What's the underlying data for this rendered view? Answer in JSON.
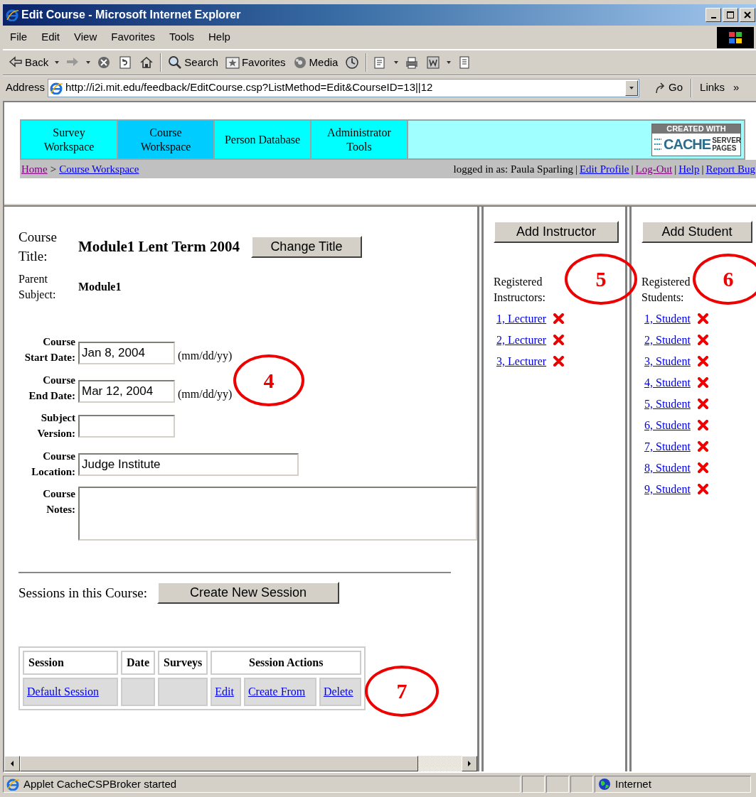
{
  "window": {
    "title": "Edit Course - Microsoft Internet Explorer"
  },
  "menu": [
    "File",
    "Edit",
    "View",
    "Favorites",
    "Tools",
    "Help"
  ],
  "toolbar": [
    {
      "kind": "back",
      "label": "Back",
      "dropdown": true
    },
    {
      "kind": "forward",
      "dropdown": true
    },
    {
      "kind": "stop"
    },
    {
      "kind": "refresh"
    },
    {
      "kind": "home"
    },
    {
      "kind": "search",
      "label": "Search"
    },
    {
      "kind": "favorites",
      "label": "Favorites"
    },
    {
      "kind": "media",
      "label": "Media"
    },
    {
      "kind": "history"
    },
    {
      "kind": "mail",
      "dropdown": true
    },
    {
      "kind": "print"
    },
    {
      "kind": "edit",
      "dropdown": true
    },
    {
      "kind": "discuss"
    }
  ],
  "address": {
    "label": "Address",
    "value": "http://i2i.mit.edu/feedback/EditCourse.csp?ListMethod=Edit&CourseID=13||12",
    "go": "Go",
    "links": "Links",
    "more": "»"
  },
  "site_nav": {
    "tabs": [
      {
        "label": "Survey Workspace",
        "selected": false
      },
      {
        "label": "Course Workspace",
        "selected": true
      },
      {
        "label": "Person Database",
        "selected": false
      },
      {
        "label": "Administrator Tools",
        "selected": false
      }
    ],
    "logo": {
      "top": "CREATED WITH",
      "main": "CACHE",
      "side": [
        "SERVER",
        "PAGES"
      ]
    },
    "breadcrumb": [
      {
        "label": "Home",
        "visited": true
      },
      {
        "label": "Course Workspace",
        "visited": false
      }
    ],
    "separator": ">",
    "divider": "|",
    "user": "logged in as: Paula Sparling",
    "links": [
      {
        "label": "Edit Profile",
        "visited": false
      },
      {
        "label": "Log-Out",
        "visited": true
      },
      {
        "label": "Help",
        "visited": false
      },
      {
        "label": "Report Bug",
        "visited": false
      }
    ]
  },
  "course": {
    "title_label": "Course Title:",
    "title": "Module1 Lent Term 2004",
    "change_title": "Change Title",
    "parent_label": "Parent Subject:",
    "parent": "Module1",
    "fields": [
      {
        "kind": "date",
        "label": "Course Start Date:",
        "value": "Jan 8, 2004",
        "hint": "(mm/dd/yy)"
      },
      {
        "kind": "date",
        "label": "Course End Date:",
        "value": "Mar 12, 2004",
        "hint": "(mm/dd/yy)"
      },
      {
        "kind": "short",
        "label": "Subject Version:"
      },
      {
        "kind": "long",
        "label": "Course Location:",
        "value": "Judge Institute"
      },
      {
        "kind": "notes",
        "label": "Course Notes:"
      }
    ],
    "annotation": "4"
  },
  "sessions": {
    "label": "Sessions in this Course:",
    "create": "Create New Session",
    "columns": [
      "Session",
      "Date",
      "Surveys",
      "Session Actions"
    ],
    "rows": [
      {
        "session": "Default Session",
        "actions": [
          "Edit",
          "Create From",
          "Delete"
        ]
      }
    ],
    "annotation": "7"
  },
  "instructors": {
    "button": "Add Instructor",
    "heading": "Registered Instructors:",
    "items": [
      "1, Lecturer",
      "2, Lecturer",
      "3, Lecturer"
    ],
    "annotation": "5"
  },
  "students": {
    "button": "Add Student",
    "heading": "Registered Students:",
    "items": [
      "1, Student",
      "2, Student",
      "3, Student",
      "4, Student",
      "5, Student",
      "6, Student",
      "7, Student",
      "8, Student",
      "9, Student"
    ],
    "annotation": "6"
  },
  "status_bar": {
    "text": "Applet CacheCSPBroker started",
    "zone": "Internet"
  }
}
